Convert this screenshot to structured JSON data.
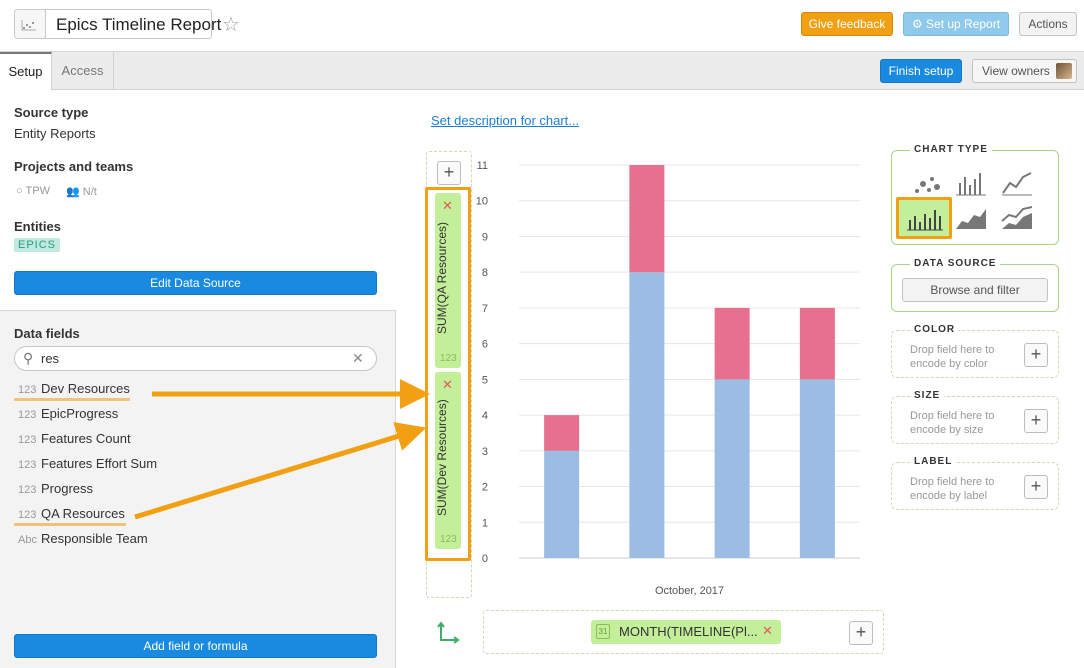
{
  "header": {
    "title": "Epics Timeline Report",
    "feedback_label": "Give feedback",
    "setup_label": "Set up Report",
    "actions_label": "Actions"
  },
  "tabs": [
    {
      "label": "Setup"
    },
    {
      "label": "Access"
    }
  ],
  "toolbar": {
    "finish_label": "Finish setup",
    "owners_label": "View owners"
  },
  "source": {
    "type_heading": "Source type",
    "type_value": "Entity Reports",
    "projects_heading": "Projects and teams",
    "project": "TPW",
    "team": "N/t",
    "entities_heading": "Entities",
    "entity_tag": "EPICS",
    "edit_label": "Edit Data Source"
  },
  "data_fields": {
    "heading": "Data fields",
    "search_value": "res",
    "items": [
      {
        "prefix": "123",
        "label": "Dev Resources"
      },
      {
        "prefix": "123",
        "label": "EpicProgress"
      },
      {
        "prefix": "123",
        "label": "Features Count"
      },
      {
        "prefix": "123",
        "label": "Features Effort Sum"
      },
      {
        "prefix": "123",
        "label": "Progress"
      },
      {
        "prefix": "123",
        "label": "QA Resources"
      },
      {
        "prefix": "Abc",
        "label": "Responsible Team"
      }
    ],
    "add_label": "Add field or formula"
  },
  "main": {
    "description_link": "Set description for chart...",
    "y_pills": [
      {
        "label": "SUM(QA Resources)",
        "type": "123"
      },
      {
        "label": "SUM(Dev Resources)",
        "type": "123"
      }
    ],
    "x_pill": {
      "label": "MONTH(TIMELINE(Pl...",
      "icon_text": "31"
    }
  },
  "chart_data": {
    "type": "bar",
    "stacked": true,
    "categories": [
      "",
      "",
      "",
      ""
    ],
    "series": [
      {
        "values": [
          3,
          8,
          5,
          5
        ],
        "color": "#9bbde3"
      },
      {
        "values": [
          1,
          3,
          2,
          2
        ],
        "color": "#e8708f"
      }
    ],
    "ylim": [
      0,
      11
    ],
    "yticks": [
      "0",
      "1",
      "2",
      "3",
      "4",
      "5",
      "6",
      "7",
      "8",
      "9",
      "10",
      "11"
    ],
    "xlabel": "October, 2017",
    "grid": true
  },
  "panels": {
    "chart_type": "CHART TYPE",
    "data_source": "DATA SOURCE",
    "browse_label": "Browse and filter",
    "color": {
      "heading": "COLOR",
      "hint": "Drop field here to encode by color"
    },
    "size": {
      "heading": "SIZE",
      "hint": "Drop field here to encode by size"
    },
    "label": {
      "heading": "LABEL",
      "hint": "Drop field here to encode by label"
    }
  },
  "colors": {
    "accent": "#1a8ae0",
    "highlight": "#f0a012",
    "pill": "#c3ee9a"
  }
}
